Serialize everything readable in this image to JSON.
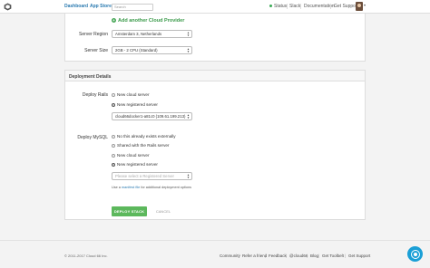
{
  "nav": {
    "dashboard": "Dashboard",
    "app_store": "App Store",
    "search_placeholder": "Search",
    "status": "Status",
    "slack": "Slack",
    "documentation": "Documentation",
    "get_support": "Get Support",
    "status_color": "#3aaa55"
  },
  "server": {
    "add_provider": "Add another Cloud Provider",
    "region_label": "Server Region",
    "region_value": "Amsterdam 3, Netherlands",
    "size_label": "Server Size",
    "size_value": "2GB - 2 CPU (Standard)"
  },
  "deployment": {
    "title": "Deployment Details",
    "rails_label": "Deploy Rails",
    "rails_options": [
      "New cloud server",
      "New registered server"
    ],
    "rails_selected": "cloud66docker1-a81c0 (109.61.199.213)",
    "mysql_label": "Deploy MySQL",
    "mysql_options": [
      "No this already exists externally",
      "Shared with the Rails server",
      "New cloud server",
      "New registered server"
    ],
    "mysql_placeholder": "Please select a Registered Server",
    "help_prefix": "Use a",
    "help_link": "manifest file",
    "help_suffix": "for additional deployment options",
    "deploy_button": "DEPLOY STACK",
    "cancel_button": "CANCEL",
    "accent_color": "#5cb85c"
  },
  "footer": {
    "copyright": "© 2011-2017 Cloud 66 Inc.",
    "links": [
      "Community",
      "Refer a friend",
      "Feedback",
      "@cloud66",
      "Blog",
      "Get Toolbelt",
      "Get Support"
    ]
  }
}
